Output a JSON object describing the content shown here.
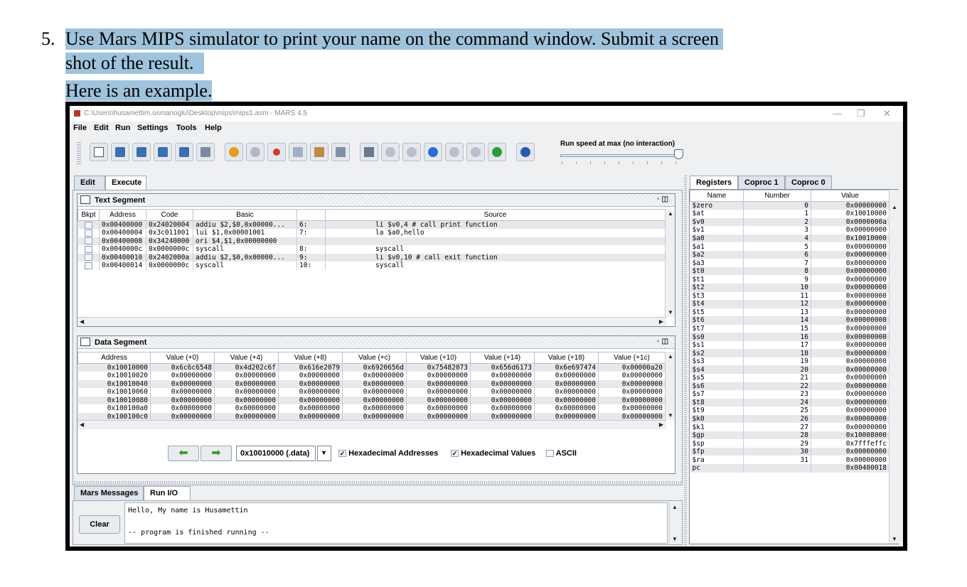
{
  "doc": {
    "number": "5.",
    "line1": "Use Mars MIPS simulator to print your name on the command window. Submit a screen",
    "line2": "shot of the result.",
    "line3_a": "Here",
    "line3_b": " is an example."
  },
  "window": {
    "title": "C:\\Users\\husamettim.osmanoglu\\Desktop\\mips\\mips1.asm  - MARS 4.5",
    "minimize": "—",
    "maximize": "❐",
    "close": "✕"
  },
  "menu": [
    "File",
    "Edit",
    "Run",
    "Settings",
    "Tools",
    "Help"
  ],
  "toolbar": {
    "icons": [
      "new-file-icon",
      "open-file-icon",
      "save-icon",
      "save-as-icon",
      "dump-memory-icon",
      "print-icon",
      "undo-icon",
      "redo-icon",
      "cut-icon",
      "copy-icon",
      "paste-icon",
      "find-replace-icon",
      "assemble-icon",
      "run-icon",
      "step-icon",
      "backstep-icon",
      "pause-icon",
      "stop-icon",
      "reset-icon",
      "help-icon"
    ],
    "speed_label": "Run speed at max (no interaction)",
    "speed_level": 1.0
  },
  "main_tabs": [
    "Edit",
    "Execute"
  ],
  "text_segment": {
    "title": "Text Segment",
    "headers": [
      "Bkpt",
      "Address",
      "Code",
      "Basic",
      "",
      "Source"
    ],
    "rows": [
      {
        "address": "0x00400000",
        "code": "0x24020004",
        "basic": "addiu $2,$0,0x00000...",
        "line": "6:",
        "source": "li $v0,4 # call print function"
      },
      {
        "address": "0x00400004",
        "code": "0x3c011001",
        "basic": "lui $1,0x00001001",
        "line": "7:",
        "source": "la $a0,hello"
      },
      {
        "address": "0x00400008",
        "code": "0x34240000",
        "basic": "ori $4,$1,0x00000000",
        "line": "",
        "source": ""
      },
      {
        "address": "0x0040000c",
        "code": "0x0000000c",
        "basic": "syscall",
        "line": "8:",
        "source": "syscall"
      },
      {
        "address": "0x00400010",
        "code": "0x2402000a",
        "basic": "addiu $2,$0,0x00000...",
        "line": "9:",
        "source": "li $v0,10 # call exit function"
      },
      {
        "address": "0x00400014",
        "code": "0x0000000c",
        "basic": "syscall",
        "line": "10:",
        "source": "syscall"
      }
    ]
  },
  "data_segment": {
    "title": "Data Segment",
    "headers": [
      "Address",
      "Value (+0)",
      "Value (+4)",
      "Value (+8)",
      "Value (+c)",
      "Value (+10)",
      "Value (+14)",
      "Value (+18)",
      "Value (+1c)"
    ],
    "rows": [
      [
        "0x10010000",
        "0x6c6c6548",
        "0x4d202c6f",
        "0x616e2079",
        "0x6920656d",
        "0x75482073",
        "0x656d6173",
        "0x6e697474",
        "0x00000a20"
      ],
      [
        "0x10010020",
        "0x00000000",
        "0x00000000",
        "0x00000000",
        "0x00000000",
        "0x00000000",
        "0x00000000",
        "0x00000000",
        "0x00000000"
      ],
      [
        "0x10010040",
        "0x00000000",
        "0x00000000",
        "0x00000000",
        "0x00000000",
        "0x00000000",
        "0x00000000",
        "0x00000000",
        "0x00000000"
      ],
      [
        "0x10010060",
        "0x00000000",
        "0x00000000",
        "0x00000000",
        "0x00000000",
        "0x00000000",
        "0x00000000",
        "0x00000000",
        "0x00000000"
      ],
      [
        "0x10010080",
        "0x00000000",
        "0x00000000",
        "0x00000000",
        "0x00000000",
        "0x00000000",
        "0x00000000",
        "0x00000000",
        "0x00000000"
      ],
      [
        "0x100100a0",
        "0x00000000",
        "0x00000000",
        "0x00000000",
        "0x00000000",
        "0x00000000",
        "0x00000000",
        "0x00000000",
        "0x00000000"
      ],
      [
        "0x100100c0",
        "0x00000000",
        "0x00000000",
        "0x00000000",
        "0x00000000",
        "0x00000000",
        "0x00000000",
        "0x00000000",
        "0x00000000"
      ]
    ],
    "address_select": "0x10010000 (.data)",
    "hex_addresses_label": "Hexadecimal Addresses",
    "hex_addresses_checked": true,
    "hex_values_label": "Hexadecimal Values",
    "hex_values_checked": true,
    "ascii_label": "ASCII",
    "ascii_checked": false
  },
  "message_tabs": [
    "Mars Messages",
    "Run I/O"
  ],
  "run_io": {
    "clear_label": "Clear",
    "line1": "Hello, My name is Husamettin",
    "line2": "-- program is finished running --"
  },
  "register_tabs": [
    "Registers",
    "Coproc 1",
    "Coproc 0"
  ],
  "registers": {
    "headers": [
      "Name",
      "Number",
      "Value"
    ],
    "rows": [
      [
        "$zero",
        "0",
        "0x00000000"
      ],
      [
        "$at",
        "1",
        "0x10010000"
      ],
      [
        "$v0",
        "2",
        "0x0000000a"
      ],
      [
        "$v1",
        "3",
        "0x00000000"
      ],
      [
        "$a0",
        "4",
        "0x10010000"
      ],
      [
        "$a1",
        "5",
        "0x00000000"
      ],
      [
        "$a2",
        "6",
        "0x00000000"
      ],
      [
        "$a3",
        "7",
        "0x00000000"
      ],
      [
        "$t0",
        "8",
        "0x00000000"
      ],
      [
        "$t1",
        "9",
        "0x00000000"
      ],
      [
        "$t2",
        "10",
        "0x00000000"
      ],
      [
        "$t3",
        "11",
        "0x00000000"
      ],
      [
        "$t4",
        "12",
        "0x00000000"
      ],
      [
        "$t5",
        "13",
        "0x00000000"
      ],
      [
        "$t6",
        "14",
        "0x00000000"
      ],
      [
        "$t7",
        "15",
        "0x00000000"
      ],
      [
        "$s0",
        "16",
        "0x00000000"
      ],
      [
        "$s1",
        "17",
        "0x00000000"
      ],
      [
        "$s2",
        "18",
        "0x00000000"
      ],
      [
        "$s3",
        "19",
        "0x00000000"
      ],
      [
        "$s4",
        "20",
        "0x00000000"
      ],
      [
        "$s5",
        "21",
        "0x00000000"
      ],
      [
        "$s6",
        "22",
        "0x00000000"
      ],
      [
        "$s7",
        "23",
        "0x00000000"
      ],
      [
        "$t8",
        "24",
        "0x00000000"
      ],
      [
        "$t9",
        "25",
        "0x00000000"
      ],
      [
        "$k0",
        "26",
        "0x00000000"
      ],
      [
        "$k1",
        "27",
        "0x00000000"
      ],
      [
        "$gp",
        "28",
        "0x10008000"
      ],
      [
        "$sp",
        "29",
        "0x7fffeffc"
      ],
      [
        "$fp",
        "30",
        "0x00000000"
      ],
      [
        "$ra",
        "31",
        "0x00000000"
      ],
      [
        "pc",
        "",
        "0x00400018"
      ]
    ]
  }
}
